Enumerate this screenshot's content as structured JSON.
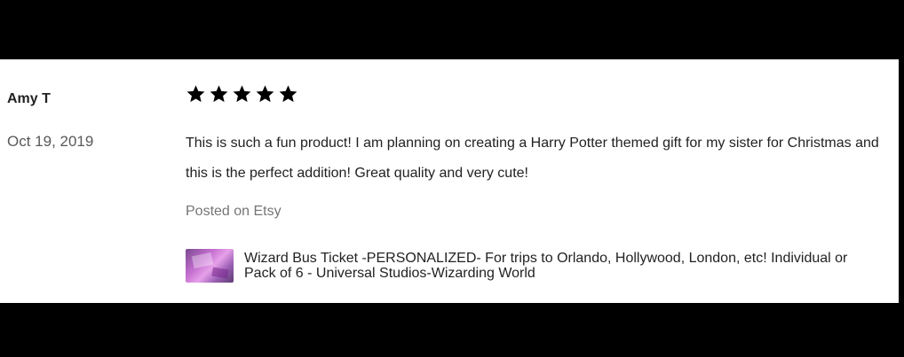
{
  "review": {
    "reviewer_name": "Amy T",
    "date": "Oct 19, 2019",
    "rating": 5,
    "rating_max": 5,
    "text": "This is such a fun product! I am planning on creating a Harry Potter themed gift for my sister for Christmas and this is the perfect addition! Great quality and very cute!",
    "posted_on": "Posted on Etsy"
  },
  "product": {
    "title": "Wizard Bus Ticket -PERSONALIZED- For trips to Orlando, Hollywood, London, etc! Individual or Pack of 6 - Universal Studios-Wizarding World",
    "thumbnail_icon": "product-thumbnail"
  },
  "colors": {
    "background": "#000000",
    "card": "#ffffff",
    "text": "#222222",
    "muted": "#757575",
    "star": "#000000"
  }
}
